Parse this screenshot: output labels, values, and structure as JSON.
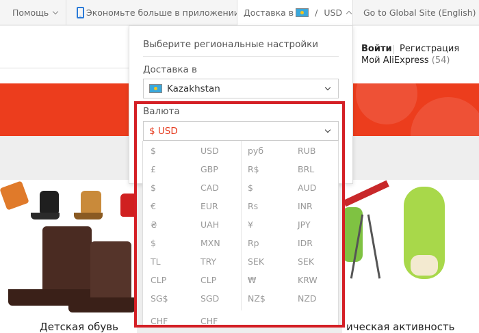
{
  "topbar": {
    "help_label": "Помощь",
    "app_promo_label": "Экономьте больше в приложении!",
    "delivery_label": "Доставка в",
    "currency_sep": "/",
    "currency_short": "USD",
    "global_site_label": "Go to Global Site (English)"
  },
  "header": {
    "login_label": "Войти",
    "register_label": "Регистрация",
    "my_ali_label": "Мой AliExpress",
    "my_ali_count": "(54)"
  },
  "panel": {
    "title": "Выберите региональные настройки",
    "ship_to_label": "Доставка в",
    "country_value": "Kazakhstan",
    "currency_label": "Валюта",
    "currency_value": "$ USD"
  },
  "currencies": [
    {
      "s1": "$",
      "c1": "USD",
      "s2": "руб",
      "c2": "RUB"
    },
    {
      "s1": "£",
      "c1": "GBP",
      "s2": "R$",
      "c2": "BRL"
    },
    {
      "s1": "$",
      "c1": "CAD",
      "s2": "$",
      "c2": "AUD"
    },
    {
      "s1": "€",
      "c1": "EUR",
      "s2": "Rs",
      "c2": "INR"
    },
    {
      "s1": "₴",
      "c1": "UAH",
      "s2": "¥",
      "c2": "JPY"
    },
    {
      "s1": "$",
      "c1": "MXN",
      "s2": "Rp",
      "c2": "IDR"
    },
    {
      "s1": "TL",
      "c1": "TRY",
      "s2": "SEK",
      "c2": "SEK"
    },
    {
      "s1": "CLP",
      "c1": "CLP",
      "s2": "₩",
      "c2": "KRW"
    },
    {
      "s1": "SG$",
      "c1": "SGD",
      "s2": "NZ$",
      "c2": "NZD"
    },
    {
      "s1": "CHF",
      "c1": "CHF",
      "s2": "",
      "c2": ""
    }
  ],
  "cards": {
    "left_title": "Детская обувь",
    "right_title": "ическая активность"
  },
  "colors": {
    "brand_red": "#ec3d1d",
    "highlight_red": "#d41f25",
    "selected_currency": "#e6391c"
  },
  "icons": [
    "chevron-down-icon",
    "phone-icon",
    "kazakhstan-flag-icon",
    "chevron-up-icon"
  ]
}
